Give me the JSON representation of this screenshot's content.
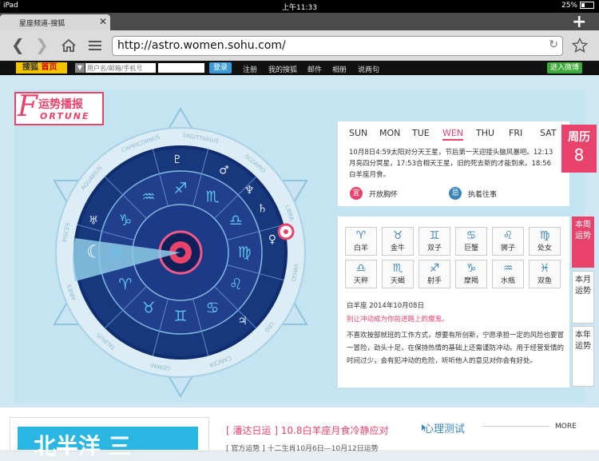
{
  "status_bar": {
    "device": "iPad",
    "time": "上午11:33",
    "battery": "25%"
  },
  "browser": {
    "tab_title": "星座频道-搜狐",
    "tab_close": "✕",
    "new_tab": "+",
    "url": "http://astro.women.sohu.com/"
  },
  "sohu_bar": {
    "logo": "搜狐",
    "logo_home": "首页",
    "username_placeholder": "用户名/邮箱/手机号",
    "login": "登录",
    "links": [
      "注册",
      "我的搜狐",
      "邮件",
      "相册",
      "说两句"
    ],
    "weibo": "进入微博"
  },
  "fortune_badge": {
    "title_cn": "运势播报",
    "letter": "F",
    "title_en": "ORTUNE"
  },
  "daily": {
    "weekdays": [
      "SUN",
      "MON",
      "TUE",
      "WEN",
      "THU",
      "FRI",
      "SAT"
    ],
    "active_day": "WEN",
    "text": "10月8日4:59太阳对分天王星，节后第一天迎接头脑风暴吧。12:13月亮四分冥星，17:53合相天王星，旧的死去新的才能到来。18:56白羊座月食。",
    "yi_label": "宜",
    "yi_text": "开放胸怀",
    "ji_label": "忌",
    "ji_text": "执着往事",
    "weekly_label": "周历",
    "weekly_day": "8"
  },
  "zodiac": {
    "signs": [
      {
        "symbol": "♈",
        "name": "白羊"
      },
      {
        "symbol": "♉",
        "name": "金牛"
      },
      {
        "symbol": "♊",
        "name": "双子"
      },
      {
        "symbol": "♋",
        "name": "巨蟹"
      },
      {
        "symbol": "♌",
        "name": "狮子"
      },
      {
        "symbol": "♍",
        "name": "处女"
      },
      {
        "symbol": "♎",
        "name": "天秤"
      },
      {
        "symbol": "♏",
        "name": "天蝎"
      },
      {
        "symbol": "♐",
        "name": "射手"
      },
      {
        "symbol": "♑",
        "name": "摩羯"
      },
      {
        "symbol": "♒",
        "name": "水瓶"
      },
      {
        "symbol": "♓",
        "name": "双鱼"
      }
    ],
    "heading": "白羊座 2014年10月08日",
    "subheading": "别让冲动成为你前进路上的魔鬼。",
    "body": "不喜欢按部就班的工作方式，想要有所创新，宁愿承担一定的风险也要冒一冒险，劲头十足，在保持热情的基础上还需谨防冲动。用于经营爱情的时间过少，会有犯冲动的危险，听听他人的意见对你会有好处。",
    "tabs": [
      "本周运势",
      "本月运势",
      "本年运势"
    ]
  },
  "wheel": {
    "outer_labels": [
      "CAPRICORNUS",
      "SAGITTARIUS",
      "SCORPIO",
      "LIBRA",
      "VIRGO",
      "LEO",
      "CANCER",
      "GEMINI",
      "TAURUS",
      "ARIES",
      "PISCES",
      "AQUARIUS"
    ],
    "inner_signs": [
      "♒",
      "♐",
      "♏",
      "♎",
      "♍",
      "♌",
      "♋",
      "♊",
      "♉",
      "♈",
      "♓",
      "♑"
    ],
    "planets": [
      "♇",
      "♂",
      "♆",
      "♄",
      "♀",
      "♃",
      "♅",
      "☾"
    ]
  },
  "bottom": {
    "thumb_text": "北半洋 三",
    "news_title": "[ 潘达日运 ] 10.8白羊座月食冷静应对",
    "news_sub": "[ 官方运势 ] 十二生肖10月6日—10月12日运势",
    "psy_title": "心理测试",
    "more": "MORE"
  },
  "colors": {
    "accent": "#e9436c",
    "wheel_dark": "#1f3f88",
    "wheel_mid": "#2b5aa8",
    "highlight": "#8ecbe8"
  }
}
